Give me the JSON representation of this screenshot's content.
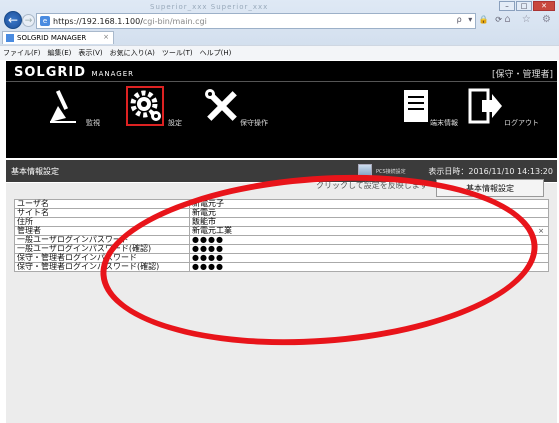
{
  "browser": {
    "url_main": "https://192.168.1.100/",
    "url_path": "cgi-bin/main.cgi",
    "tab_title": "SOLGRID MANAGER",
    "tab_close": "×",
    "addr_tools": "ρ ▾ 🔒 ⟳",
    "back_glyph": "←",
    "fwd_glyph": "→",
    "star_tools": "⌂ ☆ ⚙",
    "faded_tabs": "Superior_xxx    Superior_xxx",
    "menu": [
      "ファイル(F)",
      "編集(E)",
      "表示(V)",
      "お気に入り(A)",
      "ツール(T)",
      "ヘルプ(H)"
    ],
    "window_controls": {
      "minimize": "–",
      "maximize": "□",
      "close": "✕"
    }
  },
  "app": {
    "logo_main": "SOLGRID",
    "logo_sub": "MANAGER",
    "role": "[保守・管理者]",
    "nav": [
      {
        "label": "監視",
        "icon": "monitor-brush-icon"
      },
      {
        "label": "設定",
        "icon": "gear-icon",
        "selected": true
      },
      {
        "label": "保守操作",
        "icon": "tools-icon"
      },
      {
        "label": "端末情報",
        "icon": "document-icon"
      },
      {
        "label": "ログアウト",
        "icon": "logout-icon"
      }
    ]
  },
  "titlebar": {
    "title": "基本情報設定",
    "pcs_label": "PCS接続設定",
    "datetime": "表示日時：2016/11/10 14:13:20"
  },
  "content": {
    "note": "クリックして設定を反映します",
    "save_button": "基本情報設定",
    "rows": [
      {
        "label": "ユーザ名",
        "value": "新電元子"
      },
      {
        "label": "サイト名",
        "value": "新電元"
      },
      {
        "label": "住所",
        "value": "飯能市"
      },
      {
        "label": "管理者",
        "value": "新電元工業",
        "clear": "×"
      },
      {
        "label": "一般ユーザログインパスワード",
        "value": "●●●●"
      },
      {
        "label": "一般ユーザログインパスワード(確認)",
        "value": "●●●●"
      },
      {
        "label": "保守・管理者ログインパスワード",
        "value": "●●●●"
      },
      {
        "label": "保守・管理者ログインパスワード(確認)",
        "value": "●●●●"
      }
    ]
  },
  "colors": {
    "annotation": "#e8141a",
    "selected_nav": "#dd2222",
    "header_bg": "#000000"
  }
}
